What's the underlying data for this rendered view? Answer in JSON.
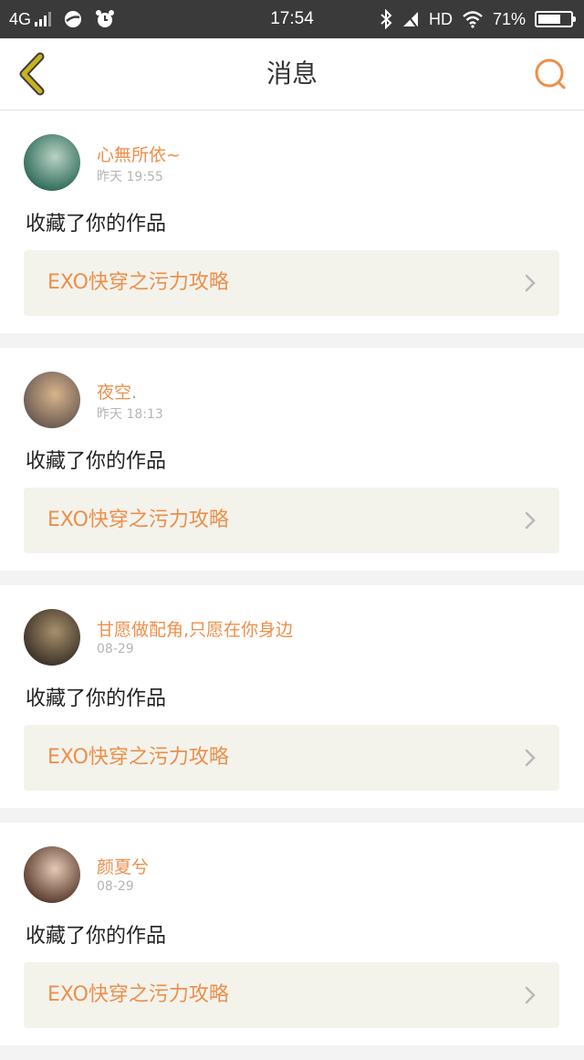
{
  "status_bar": {
    "network": "4G",
    "time": "17:54",
    "hd": "HD",
    "battery_text": "71%",
    "battery_level": 0.71,
    "icons": [
      "signal-icon",
      "browser-icon",
      "alarm-icon",
      "bluetooth-icon",
      "muted-signal-icon",
      "wifi-icon",
      "battery-icon"
    ]
  },
  "header": {
    "title": "消息",
    "back_icon": "chevron-left-icon",
    "search_icon": "search-icon"
  },
  "theme": {
    "accent": "#ee8f4b",
    "back_color": "#c9b21d",
    "card_link_bg": "#f3f3ec"
  },
  "messages": [
    {
      "username": "心無所依~",
      "time": "昨天 19:55",
      "action": "收藏了你的作品",
      "work_title": "EXO快穿之污力攻略",
      "avatar_colors": [
        "#2f6b5a",
        "#b9d3c4"
      ]
    },
    {
      "username": "夜空.",
      "time": "昨天 18:13",
      "action": "收藏了你的作品",
      "work_title": "EXO快穿之污力攻略",
      "avatar_colors": [
        "#6b5a52",
        "#d8b58c"
      ]
    },
    {
      "username": "甘愿做配角,只愿在你身边",
      "time": "08-29",
      "action": "收藏了你的作品",
      "work_title": "EXO快穿之污力攻略",
      "avatar_colors": [
        "#3c3228",
        "#a8906c"
      ]
    },
    {
      "username": "颜夏兮",
      "time": "08-29",
      "action": "收藏了你的作品",
      "work_title": "EXO快穿之污力攻略",
      "avatar_colors": [
        "#5a3b2e",
        "#e6c9b6"
      ]
    }
  ]
}
